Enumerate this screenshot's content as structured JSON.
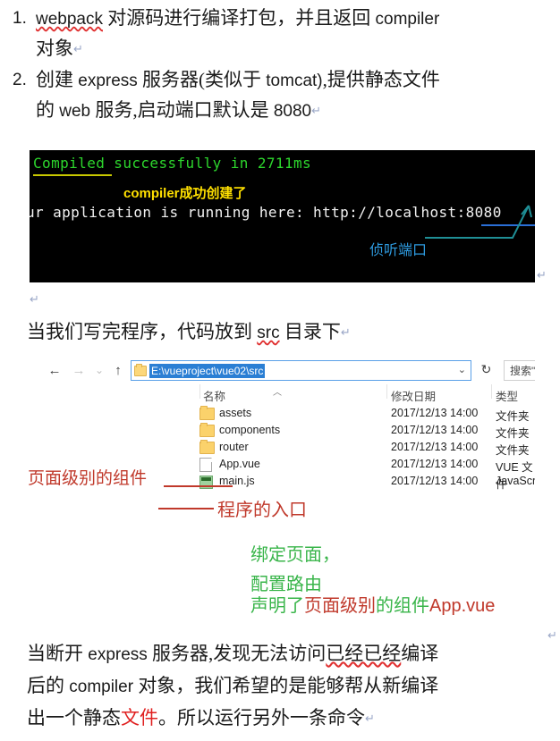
{
  "list": {
    "items": [
      {
        "number": "1.",
        "seg_code": "webpack",
        "seg_cn1": " 对源码进行编译打包，并且返回 ",
        "seg_code2": "compiler",
        "line2": "对象",
        "pilcrow": "↵"
      },
      {
        "number": "2.",
        "seg_cn_a": "创建 ",
        "seg_code": "express",
        "seg_cn_b": " 服务器(类似于 ",
        "seg_code2": "tomcat)",
        "seg_cn_c": ",提供静态文件",
        "line2_a": "的 ",
        "line2_code": "web",
        "line2_b": " 服务,启动端口默认是 ",
        "line2_num": "8080",
        "pilcrow": "↵"
      }
    ]
  },
  "terminal": {
    "line1": "Compiled successfully in 2711ms",
    "annotation_yellow": "compiler成功创建了",
    "line2": "ur application is running here: http://localhost:8080",
    "annotation_blue": "侦听端口",
    "pilcrow": "↵",
    "colors": {
      "background": "#000000",
      "green": "#2dd62d",
      "yellow": "#ffe000",
      "olive_underline": "#c8c800",
      "white": "#f2f2f2",
      "blue_underline": "#2a6fd6",
      "cyan_annotation": "#2e9be0"
    }
  },
  "mid_paragraph": {
    "blank_pilcrow": "↵",
    "text_a": "当我们写完程序，代码放到 ",
    "code": "src",
    "text_b": " 目录下",
    "pilcrow": "↵"
  },
  "explorer": {
    "nav": {
      "back": "←",
      "forward": "→",
      "history": "⌄",
      "up": "↑"
    },
    "address": {
      "value": "E:\\vueproject\\vue02\\src",
      "chevron": "⌄"
    },
    "refresh_icon": "↻",
    "search": {
      "value": "搜索\"s",
      "chevron": "⌄"
    },
    "columns": [
      "名称",
      "修改日期",
      "类型"
    ],
    "sort_caret": "︿",
    "rows": [
      {
        "icon": "folder-icon",
        "name": "assets",
        "date": "2017/12/13 14:00",
        "type": "文件夹"
      },
      {
        "icon": "folder-icon",
        "name": "components",
        "date": "2017/12/13 14:00",
        "type": "文件夹"
      },
      {
        "icon": "folder-icon",
        "name": "router",
        "date": "2017/12/13 14:00",
        "type": "文件夹"
      },
      {
        "icon": "vue-file-icon",
        "name": "App.vue",
        "date": "2017/12/13 14:00",
        "type": "VUE 文件"
      },
      {
        "icon": "js-file-icon",
        "name": "main.js",
        "date": "2017/12/13 14:00",
        "type": "JavaScript"
      }
    ]
  },
  "annotations": {
    "red_component": "页面级别的组件",
    "red_entry": "程序的入口",
    "green_bind": "绑定页面，",
    "green_route": "配置路由",
    "green_declare_a": "声明了",
    "green_declare_red1": "页面级别",
    "green_declare_b": "的组件",
    "green_declare_red2": "App.vue",
    "colors": {
      "red": "#c0392b",
      "green": "#39b54a"
    }
  },
  "bottom_paragraph": {
    "line1_a": "当断开 ",
    "line1_code": "express",
    "line1_b": " 服务器,发现无法访问",
    "line1_spell": "已经已经",
    "line1_c": "编译",
    "line2_a": "后的 ",
    "line2_code": "compiler",
    "line2_b": " 对象，我们希望的是能够帮从新编译",
    "line3_a": "出一个静态",
    "line3_red": "文件",
    "line3_b": "。所以运行另外一条命令",
    "pilcrow": "↵",
    "top_pilcrow": "↵"
  }
}
